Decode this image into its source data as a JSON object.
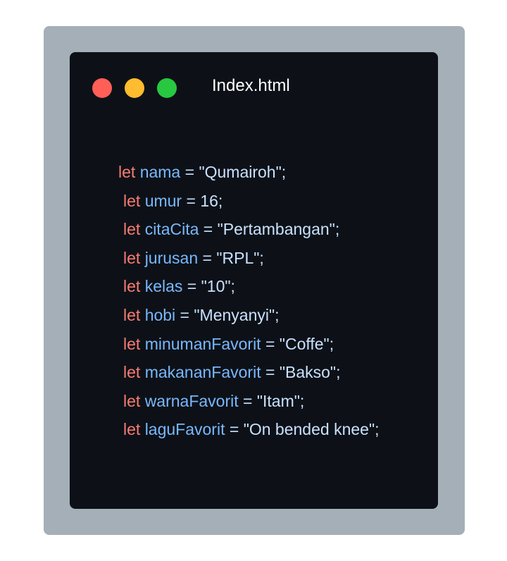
{
  "window": {
    "title": "Index.html",
    "buttons": [
      {
        "name": "close",
        "color": "#ff5f57"
      },
      {
        "name": "minimize",
        "color": "#febc2e"
      },
      {
        "name": "zoom",
        "color": "#28c840"
      }
    ]
  },
  "code": {
    "lines": [
      {
        "keyword": "let",
        "name": "nama",
        "op": " = ",
        "value": "\"Qumairoh\"",
        "end": ";"
      },
      {
        "keyword": "let",
        "name": "umur",
        "op": " = ",
        "value": "16",
        "end": ";"
      },
      {
        "keyword": "let",
        "name": "citaCita",
        "op": " = ",
        "value": "\"Pertambangan\"",
        "end": ";"
      },
      {
        "keyword": "let",
        "name": "jurusan",
        "op": " = ",
        "value": "\"RPL\"",
        "end": ";"
      },
      {
        "keyword": "let",
        "name": "kelas",
        "op": " = ",
        "value": "\"10\"",
        "end": ";"
      },
      {
        "keyword": "let",
        "name": "hobi",
        "op": " = ",
        "value": "\"Menyanyi\"",
        "end": ";"
      },
      {
        "keyword": "let",
        "name": "minumanFavorit",
        "op": " = ",
        "value": "\"Coffe\"",
        "end": ";"
      },
      {
        "keyword": "let",
        "name": "makananFavorit",
        "op": " = ",
        "value": "\"Bakso\"",
        "end": ";"
      },
      {
        "keyword": "let",
        "name": "warnaFavorit",
        "op": " = ",
        "value": "\"Itam\"",
        "end": ";"
      },
      {
        "keyword": "let",
        "name": "laguFavorit",
        "op": " = ",
        "value": "\"On bended knee\"",
        "end": ";"
      }
    ]
  }
}
